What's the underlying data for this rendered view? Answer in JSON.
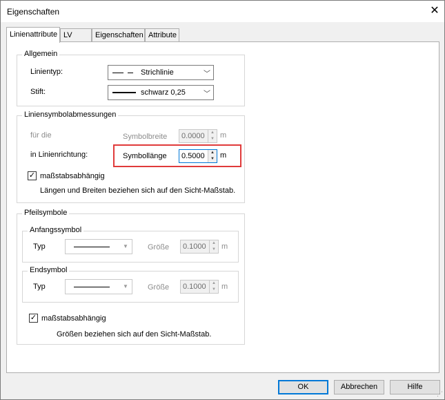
{
  "window": {
    "title": "Eigenschaften",
    "close_glyph": "✕"
  },
  "tabs": [
    {
      "label": "Linienattribute",
      "active": true
    },
    {
      "label": "LV",
      "active": false
    },
    {
      "label": "Eigenschaften",
      "active": false
    },
    {
      "label": "Attribute",
      "active": false
    }
  ],
  "allgemein": {
    "legend": "Allgemein",
    "linientyp_label": "Linientyp:",
    "linientyp_value": "Strichlinie",
    "stift_label": "Stift:",
    "stift_value": "schwarz 0,25"
  },
  "liniensymbol": {
    "legend": "Liniensymbolabmessungen",
    "fuer_die_label": "für die",
    "symbolbreite_label": "Symbolbreite",
    "symbolbreite_value": "0.0000",
    "symbolbreite_unit": "m",
    "in_linienrichtung_label": "in Linienrichtung:",
    "symbollaenge_label": "Symbollänge",
    "symbollaenge_value": "0.5000",
    "symbollaenge_unit": "m",
    "massstab_label": "maßstabsabhängig",
    "massstab_checked": true,
    "hint": "Längen und Breiten beziehen sich auf den Sicht-Maßstab."
  },
  "pfeilsymbole": {
    "legend": "Pfeilsymbole",
    "anfang": {
      "legend": "Anfangssymbol",
      "typ_label": "Typ",
      "groesse_label": "Größe",
      "groesse_value": "0.1000",
      "unit": "m"
    },
    "end": {
      "legend": "Endsymbol",
      "typ_label": "Typ",
      "groesse_label": "Größe",
      "groesse_value": "0.1000",
      "unit": "m"
    },
    "massstab_label": "maßstabsabhängig",
    "massstab_checked": true,
    "hint": "Größen beziehen sich auf den Sicht-Maßstab."
  },
  "footer": {
    "ok": "OK",
    "abbrechen": "Abbrechen",
    "hilfe": "Hilfe"
  },
  "colors": {
    "highlight": "#e03a3a",
    "focus": "#0078d7"
  }
}
